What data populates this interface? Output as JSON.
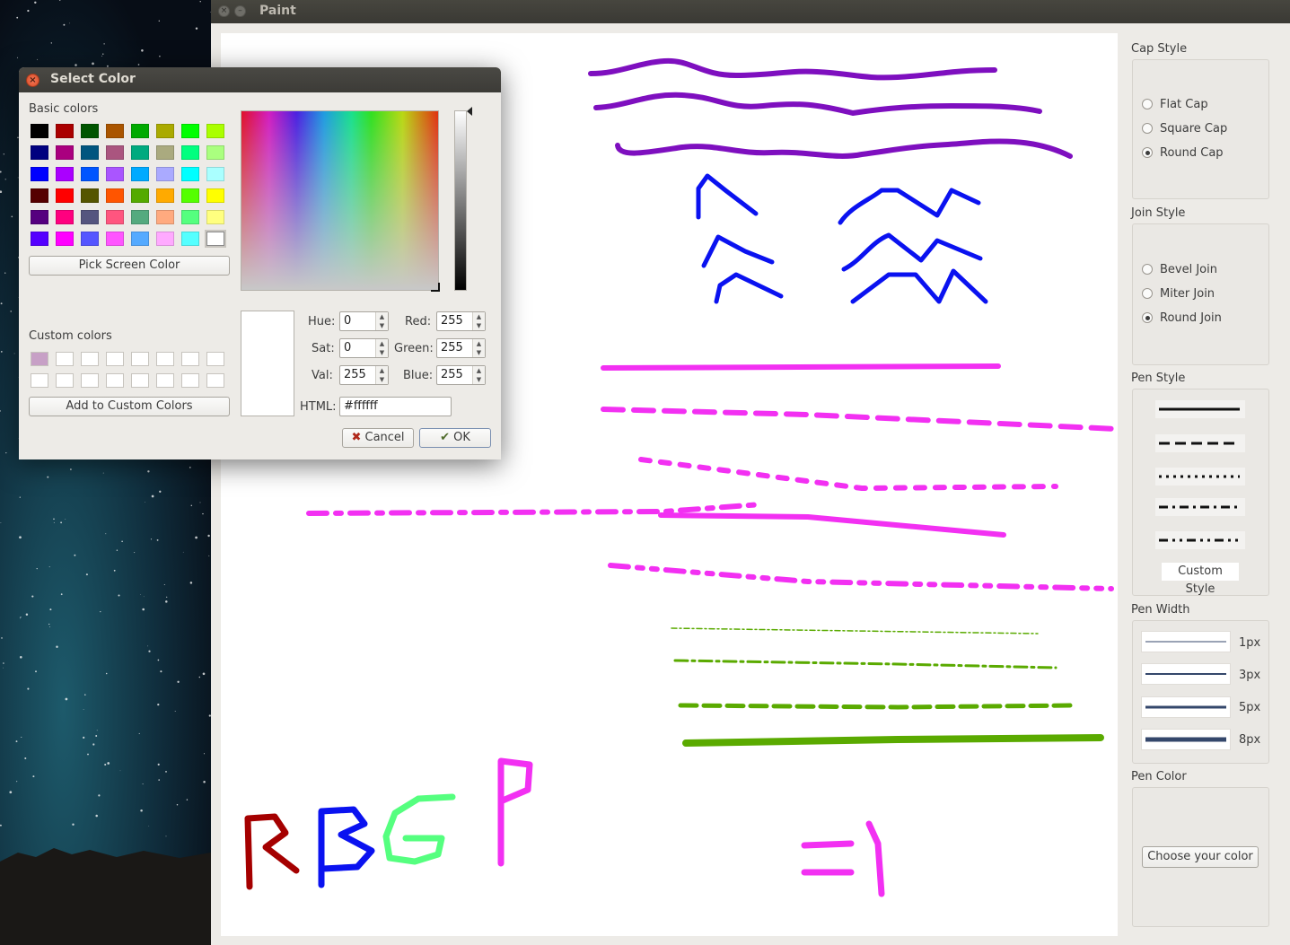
{
  "window": {
    "title": "Paint"
  },
  "side_panel": {
    "cap_style": {
      "label": "Cap Style",
      "options": [
        "Flat Cap",
        "Square Cap",
        "Round Cap"
      ],
      "selected": "Round Cap"
    },
    "join_style": {
      "label": "Join Style",
      "options": [
        "Bevel Join",
        "Miter Join",
        "Round Join"
      ],
      "selected": "Round Join"
    },
    "pen_style": {
      "label": "Pen Style",
      "custom_label": "Custom Style"
    },
    "pen_width": {
      "label": "Pen Width",
      "options": [
        "1px",
        "3px",
        "5px",
        "8px"
      ]
    },
    "pen_color": {
      "label": "Pen Color",
      "button_label": "Choose your color"
    }
  },
  "dialog": {
    "title": "Select Color",
    "basic_colors_label": "Basic colors",
    "pick_screen_label": "Pick Screen Color",
    "custom_colors_label": "Custom colors",
    "add_custom_label": "Add to Custom Colors",
    "basic_colors": [
      "#000000",
      "#aa0000",
      "#005500",
      "#aa5500",
      "#00aa00",
      "#aaaa00",
      "#00ff00",
      "#aaff00",
      "#00007f",
      "#aa007f",
      "#00557f",
      "#aa557f",
      "#00aa7f",
      "#aaaa7f",
      "#00ff7f",
      "#aaff7f",
      "#0000ff",
      "#aa00ff",
      "#0055ff",
      "#aa55ff",
      "#00aaff",
      "#aaaaff",
      "#00ffff",
      "#aaffff",
      "#550000",
      "#ff0000",
      "#555500",
      "#ff5500",
      "#55aa00",
      "#ffaa00",
      "#55ff00",
      "#ffff00",
      "#55007f",
      "#ff007f",
      "#55557f",
      "#ff557f",
      "#55aa7f",
      "#ffaa7f",
      "#55ff7f",
      "#ffff7f",
      "#5500ff",
      "#ff00ff",
      "#5555ff",
      "#ff55ff",
      "#55aaff",
      "#ffaaff",
      "#55ffff",
      "#ffffff"
    ],
    "custom_colors": [
      "#c7a0c6"
    ],
    "fields": {
      "hue_label": "Hue:",
      "hue": "0",
      "sat_label": "Sat:",
      "sat": "0",
      "val_label": "Val:",
      "val": "255",
      "red_label": "Red:",
      "red": "255",
      "green_label": "Green:",
      "green": "255",
      "blue_label": "Blue:",
      "blue": "255",
      "html_label": "HTML:",
      "html": "#ffffff"
    },
    "cancel_label": "Cancel",
    "ok_label": "OK"
  },
  "canvas": {
    "text_strokes": [
      "RBGP",
      "=1"
    ],
    "stroke_colors": {
      "purple": "#7e0fbf",
      "blue": "#0a12f0",
      "magenta": "#f230f2",
      "green": "#5aaa00",
      "dark_red": "#a50000",
      "light_green": "#55ff7f"
    }
  }
}
